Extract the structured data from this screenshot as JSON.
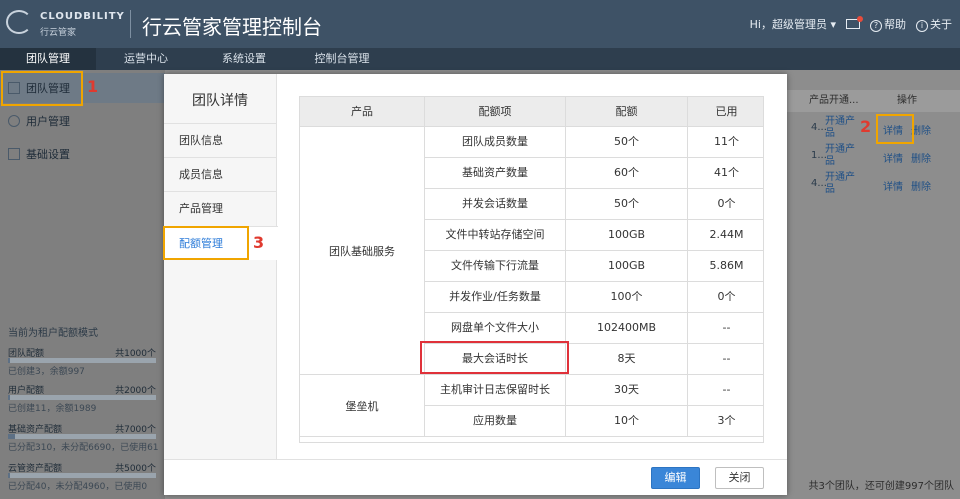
{
  "header": {
    "brand": "CLOUDBILITY",
    "brand_cn": "行云管家",
    "title": "行云管家管理控制台",
    "greeting": "Hi，超级管理员",
    "help": "帮助",
    "about": "关于"
  },
  "nav": {
    "items": [
      "团队管理",
      "运营中心",
      "系统设置",
      "控制台管理"
    ]
  },
  "sidebar": {
    "items": [
      "团队管理",
      "用户管理",
      "基础设置"
    ],
    "quota_title": "当前为租户配额模式",
    "quotas": [
      {
        "name": "团队配额",
        "total": "共1000个",
        "detail": "已创建3，余额997",
        "used_fraction": 0.003
      },
      {
        "name": "用户配额",
        "total": "共2000个",
        "detail": "已创建11，余额1989",
        "used_fraction": 0.0055
      },
      {
        "name": "基础资产配额",
        "total": "共7000个",
        "detail": "已分配310，未分配6690，已使用61",
        "used_fraction": 0.044
      },
      {
        "name": "云管资产配额",
        "total": "共5000个",
        "detail": "已分配40，未分配4960，已使用0",
        "used_fraction": 0.008
      }
    ]
  },
  "background": {
    "col_product": "产品开通...",
    "col_action": "操作",
    "rows": [
      {
        "product_short": "4...",
        "open": "开通产品",
        "detail": "详情",
        "delete": "删除"
      },
      {
        "product_short": "1...",
        "open": "开通产品",
        "detail": "详情",
        "delete": "删除"
      },
      {
        "product_short": "4...",
        "open": "开通产品",
        "detail": "详情",
        "delete": "删除"
      }
    ],
    "footer": "共3个团队，还可创建997个团队"
  },
  "annotations": [
    "1",
    "2",
    "3"
  ],
  "modal": {
    "title": "团队详情",
    "menu": [
      "团队信息",
      "成员信息",
      "产品管理",
      "配额管理"
    ],
    "table": {
      "headers": [
        "产品",
        "配额项",
        "配额",
        "已用"
      ],
      "groups": [
        {
          "name": "团队基础服务",
          "rows": [
            [
              "团队成员数量",
              "50个",
              "11个"
            ],
            [
              "基础资产数量",
              "60个",
              "41个"
            ],
            [
              "并发会话数量",
              "50个",
              "0个"
            ],
            [
              "文件中转站存储空间",
              "100GB",
              "2.44M"
            ],
            [
              "文件传输下行流量",
              "100GB",
              "5.86M"
            ],
            [
              "并发作业/任务数量",
              "100个",
              "0个"
            ],
            [
              "网盘单个文件大小",
              "102400MB",
              "--"
            ],
            [
              "最大会话时长",
              "8天",
              "--"
            ]
          ]
        },
        {
          "name": "堡垒机",
          "rows": [
            [
              "主机审计日志保留时长",
              "30天",
              "--"
            ],
            [
              "应用数量",
              "10个",
              "3个"
            ]
          ]
        }
      ]
    },
    "buttons": {
      "edit": "编辑",
      "close": "关闭"
    }
  },
  "colors": {
    "header_bg": "#3e5266",
    "accent": "#3a86d8",
    "highlight_orange": "#f0a500",
    "highlight_red": "#e0313a"
  }
}
